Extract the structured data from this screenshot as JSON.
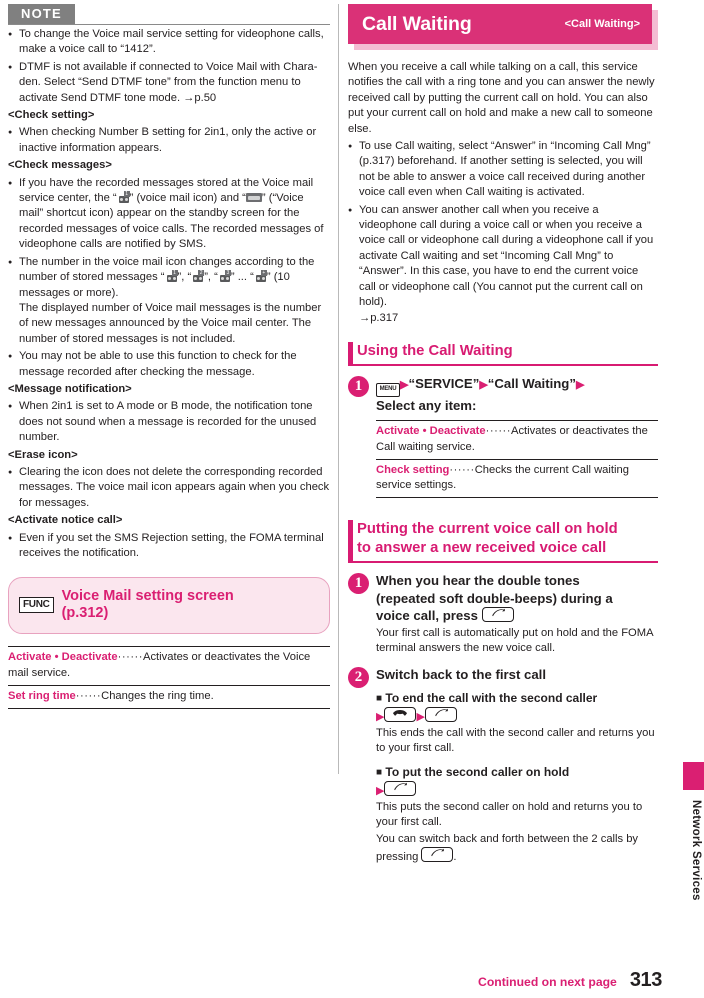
{
  "colors": {
    "accent_pink": "#da1f72",
    "header_pink": "#da3177",
    "header_shadow_pink": "#f4bcd3",
    "func_box_bg": "#fbe6ee",
    "func_box_border": "#e8a2bf",
    "note_gray": "#808080",
    "text_black": "#231f20"
  },
  "left_column": {
    "note_banner_label": "NOTE",
    "notes": [
      {
        "type": "bullet",
        "text": "To change the Voice mail service setting for videophone calls, make a voice call to “1412”."
      },
      {
        "type": "bullet",
        "text": "DTMF is not available if connected to Voice Mail with Chara-den. Select “Send DTMF tone” from the function menu to activate Send DTMF tone mode.",
        "reference": "→p.50"
      },
      {
        "type": "subhead",
        "text": "<Check setting>"
      },
      {
        "type": "bullet",
        "text": "When checking Number B setting for 2in1, only the active or inactive information appears."
      },
      {
        "type": "subhead",
        "text": "<Check messages>"
      },
      {
        "type": "bullet-icons-1",
        "text_part_1": "If you have the recorded messages stored at the Voice mail service center, the “",
        "text_part_2": "” (voice mail icon) and “",
        "text_part_3": "” (“Voice mail” shortcut icon) appear on the standby screen for the recorded messages of voice calls. The recorded messages of videophone calls are notified by SMS."
      },
      {
        "type": "bullet-icons-2",
        "text_part_1": "The number in the voice mail icon changes according to the number of stored messages “",
        "text_part_2": "”, “",
        "text_part_3": "”, “",
        "text_part_4": "” ... “",
        "text_part_5": "” (10 messages or more).",
        "text_part_6": "The displayed number of Voice mail messages is the number of new messages announced by the Voice mail center. The number of stored messages is not included."
      },
      {
        "type": "bullet",
        "text": "You may not be able to use this function to check for the message recorded after checking the message."
      },
      {
        "type": "subhead",
        "text": "<Message notification>"
      },
      {
        "type": "bullet",
        "text": "When 2in1 is set to A mode or B mode, the notification tone does not sound when a message is recorded for the unused number."
      },
      {
        "type": "subhead",
        "text": "<Erase icon>"
      },
      {
        "type": "bullet",
        "text": "Clearing the icon does not delete the corresponding recorded messages. The voice mail icon appears again when you check for messages."
      },
      {
        "type": "subhead",
        "text": "<Activate notice call>"
      },
      {
        "type": "bullet",
        "text": "Even if you set the SMS Rejection setting, the FOMA terminal receives the notification."
      }
    ],
    "func_box": {
      "chip_label": "FUNC",
      "title_line_1": "Voice Mail setting screen",
      "title_line_2": "(p.312)"
    },
    "func_items": [
      {
        "term": "Activate • Deactivate",
        "dots": "······",
        "description": "Activates or deactivates the Voice mail service."
      },
      {
        "term": "Set ring time",
        "dots": "······",
        "description": "Changes the ring time."
      }
    ]
  },
  "right_column": {
    "header": {
      "title": "Call Waiting",
      "tag": "<Call Waiting>"
    },
    "intro_paragraph": "When you receive a call while talking on a call, this service notifies the call with a ring tone and you can answer the newly received call by putting the current call on hold. You can also put your current call on hold and make a new call to someone else.",
    "intro_bullets": [
      {
        "text": "To use Call waiting, select “Answer” in “Incoming Call Mng” (p.317) beforehand. If another setting is selected, you will not be able to answer a voice call received during another voice call even when Call waiting is activated."
      },
      {
        "text": "You can answer another call when you receive a videophone call during a voice call or when you receive a voice call or videophone call during a videophone call if you activate Call waiting and set “Incoming Call Mng” to “Answer”. In this case, you have to end the current voice call or videophone call (You cannot put the current call on hold).",
        "reference": "→p.317"
      }
    ],
    "section_1": {
      "heading": "Using the Call Waiting",
      "step_number": "1",
      "step_title_key": "MENU",
      "step_title_part_1": "“SERVICE”",
      "step_title_part_2": "“Call Waiting”",
      "step_title_part_3": "Select any item:",
      "items": [
        {
          "term": "Activate • Deactivate",
          "dots": "······",
          "description": "Activates or deactivates the Call waiting service."
        },
        {
          "term": "Check setting",
          "dots": "······",
          "description": "Checks the current Call waiting service settings."
        }
      ]
    },
    "section_2": {
      "heading_line_1": "Putting the current voice call on hold",
      "heading_line_2": "to answer a new received voice call",
      "step_1": {
        "number": "1",
        "title_line_1": "When you hear the double tones",
        "title_line_2": "(repeated soft double-beeps) during a",
        "title_line_3": "voice call, press",
        "body": "Your first call is automatically put on hold and the FOMA terminal answers the new voice call."
      },
      "step_2": {
        "number": "2",
        "title": "Switch back to the first call",
        "sub_1": {
          "heading": "To end the call with the second caller",
          "body": "This ends the call with the second caller and returns you to your first call."
        },
        "sub_2": {
          "heading": "To put the second caller on hold",
          "body_line_1": "This puts the second caller on hold and returns you to your first call.",
          "body_line_2_pre": "You can switch back and forth between the 2 calls by pressing",
          "body_line_2_post": "."
        }
      }
    }
  },
  "sidebar": {
    "tab_label": "Network Services"
  },
  "footer": {
    "continued_label": "Continued on next page",
    "page_number": "313"
  }
}
